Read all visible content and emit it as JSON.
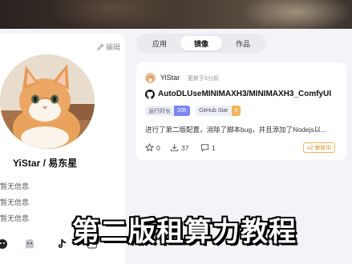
{
  "profile": {
    "edit_label": "编辑",
    "username": "YiStar / 易东星",
    "info_lines": [
      "暂无信息",
      "暂无信息",
      "暂无信息"
    ]
  },
  "tabs": [
    {
      "label": "应用",
      "active": false
    },
    {
      "label": "镜像",
      "active": true
    },
    {
      "label": "作品",
      "active": false
    }
  ],
  "repo": {
    "author": "YiStar",
    "updated": "更新于5分前",
    "name": "AutoDLUseMINIMAXH3/MINIMAXH3_ComfyUI",
    "badges": [
      {
        "key": "运行时长",
        "value": "20h",
        "color": "#7b86f2"
      },
      {
        "key": "GitHub Star",
        "value": "0",
        "color": "#f3b45a"
      }
    ],
    "description": "进行了第二版配置，消除了脚本bug，并且添加了Nodejs以...",
    "likes": "0",
    "downloads": "37",
    "comments": "1",
    "version": "v2 审核中"
  },
  "subtitle": "第二版租算力教程"
}
